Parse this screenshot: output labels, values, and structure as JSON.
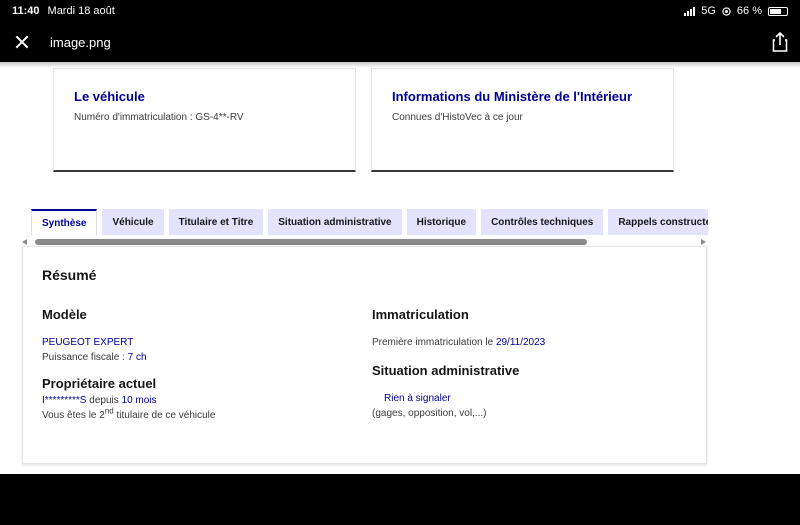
{
  "status_bar": {
    "time": "11:40",
    "date": "Mardi 18 août",
    "network": "5G",
    "battery": "66 %",
    "battery_level": 0.66
  },
  "viewer": {
    "file_name": "image.png"
  },
  "cards": [
    {
      "title": "Le véhicule",
      "text": "Numéro d'immatriculation : GS-4**-RV"
    },
    {
      "title": "Informations du Ministère de l'Intérieur",
      "text": "Connues d'HistoVec à ce jour"
    }
  ],
  "tabs": [
    {
      "label": "Synthèse",
      "active": true
    },
    {
      "label": "Véhicule",
      "active": false
    },
    {
      "label": "Titulaire et Titre",
      "active": false
    },
    {
      "label": "Situation administrative",
      "active": false
    },
    {
      "label": "Historique",
      "active": false
    },
    {
      "label": "Contrôles techniques",
      "active": false
    },
    {
      "label": "Rappels constructeur",
      "active": false
    }
  ],
  "summary": {
    "title": "Résumé",
    "model": {
      "title": "Modèle",
      "name": "PEUGEOT EXPERT",
      "power_label": "Puissance fiscale : ",
      "power_value": "7 ch"
    },
    "owner": {
      "title": "Propriétaire actuel",
      "name": "I*********S",
      "since_label": " depuis ",
      "since_value": "10 mois",
      "holder_prefix": "Vous êtes le 2",
      "holder_sup": "nd",
      "holder_suffix": " titulaire de ce véhicule"
    },
    "registration": {
      "title": "Immatriculation",
      "first_label": "Première immatriculation le ",
      "first_value": "29/11/2023"
    },
    "admin": {
      "title": "Situation administrative",
      "status": "Rien à signaler",
      "detail": "(gages, opposition, vol,...)"
    }
  }
}
